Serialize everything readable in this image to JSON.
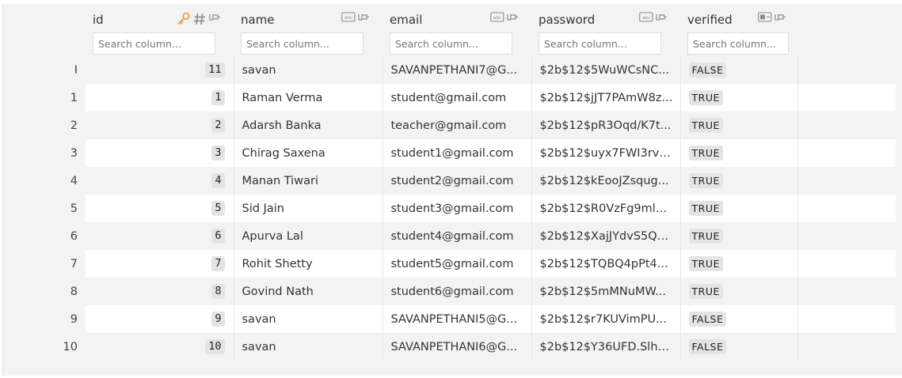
{
  "colors": {
    "key_icon": "#e09b3d",
    "header_bg": "#f3f3f3",
    "row_alt_bg": "#ffffff",
    "badge_bg": "#e4e4e4"
  },
  "columns": [
    {
      "key": "id",
      "label": "id",
      "type_icon": "hash-icon",
      "is_key": true,
      "placeholder": "Search column..."
    },
    {
      "key": "name",
      "label": "name",
      "type_icon": "text-type-icon",
      "placeholder": "Search column..."
    },
    {
      "key": "email",
      "label": "email",
      "type_icon": "text-type-icon",
      "placeholder": "Search column..."
    },
    {
      "key": "password",
      "label": "password",
      "type_icon": "text-type-icon",
      "placeholder": "Search column..."
    },
    {
      "key": "verified",
      "label": "verified",
      "type_icon": "boolean-type-icon",
      "placeholder": "Search column..."
    }
  ],
  "rows": [
    {
      "rownum": "I",
      "id": "11",
      "name": "savan",
      "email": "SAVANPETHANI7@G...",
      "password": "$2b$12$5WuWCsNC...",
      "verified": "FALSE"
    },
    {
      "rownum": "1",
      "id": "1",
      "name": "Raman Verma",
      "email": "student@gmail.com",
      "password": "$2b$12$jJT7PAmW8z...",
      "verified": "TRUE"
    },
    {
      "rownum": "2",
      "id": "2",
      "name": "Adarsh Banka",
      "email": "teacher@gmail.com",
      "password": "$2b$12$pR3Oqd/K7t...",
      "verified": "TRUE"
    },
    {
      "rownum": "3",
      "id": "3",
      "name": "Chirag Saxena",
      "email": "student1@gmail.com",
      "password": "$2b$12$uyx7FWI3rva...",
      "verified": "TRUE"
    },
    {
      "rownum": "4",
      "id": "4",
      "name": "Manan Tiwari",
      "email": "student2@gmail.com",
      "password": "$2b$12$kEooJZsqug...",
      "verified": "TRUE"
    },
    {
      "rownum": "5",
      "id": "5",
      "name": "Sid Jain",
      "email": "student3@gmail.com",
      "password": "$2b$12$R0VzFg9ml7...",
      "verified": "TRUE"
    },
    {
      "rownum": "6",
      "id": "6",
      "name": "Apurva Lal",
      "email": "student4@gmail.com",
      "password": "$2b$12$XajJYdvS5Q6...",
      "verified": "TRUE"
    },
    {
      "rownum": "7",
      "id": "7",
      "name": "Rohit Shetty",
      "email": "student5@gmail.com",
      "password": "$2b$12$TQBQ4pPt4...",
      "verified": "TRUE"
    },
    {
      "rownum": "8",
      "id": "8",
      "name": "Govind Nath",
      "email": "student6@gmail.com",
      "password": "$2b$12$5mMNuMW...",
      "verified": "TRUE"
    },
    {
      "rownum": "9",
      "id": "9",
      "name": "savan",
      "email": "SAVANPETHANI5@G...",
      "password": "$2b$12$r7KUVimPU...",
      "verified": "FALSE"
    },
    {
      "rownum": "10",
      "id": "10",
      "name": "savan",
      "email": "SAVANPETHANI6@G...",
      "password": "$2b$12$Y36UFD.SlhX...",
      "verified": "FALSE"
    }
  ]
}
